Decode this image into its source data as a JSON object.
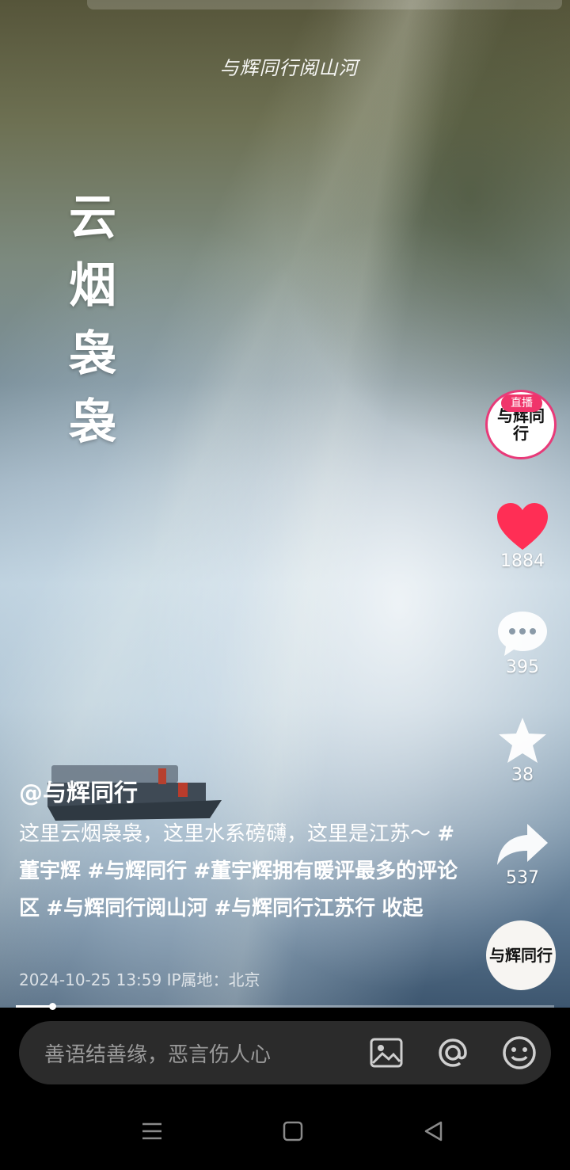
{
  "video": {
    "watermark": "与辉同行阅山河",
    "title_chars": [
      "云",
      "烟",
      "袅",
      "袅"
    ]
  },
  "rail": {
    "live_badge": "直播",
    "avatar_text": "与辉同行",
    "like_count": "1884",
    "comment_count": "395",
    "favorite_count": "38",
    "share_count": "537",
    "icons": {
      "like": "heart-icon",
      "comment": "speech-bubble-icon",
      "favorite": "star-icon",
      "share": "share-arrow-icon"
    },
    "like_color": "#ff2e55"
  },
  "post": {
    "author": "@与辉同行",
    "caption_text": "这里云烟袅袅，这里水系磅礴，这里是江苏～",
    "hashtags": [
      "#董宇辉",
      "#与辉同行",
      "#董宇辉拥有暖评最多的评论区",
      "#与辉同行阅山河",
      "#与辉同行江苏行"
    ],
    "collapse_label": "收起",
    "timestamp": "2024-10-25 13:59",
    "ip_location": "IP属地：北京"
  },
  "progress": {
    "fraction": 0.067
  },
  "comment_bar": {
    "placeholder": "善语结善缘，恶言伤人心",
    "icons": [
      "image-icon",
      "at-icon",
      "emoji-icon"
    ]
  },
  "system_nav": {
    "icons": [
      "menu-icon",
      "home-square-icon",
      "back-triangle-icon"
    ]
  }
}
